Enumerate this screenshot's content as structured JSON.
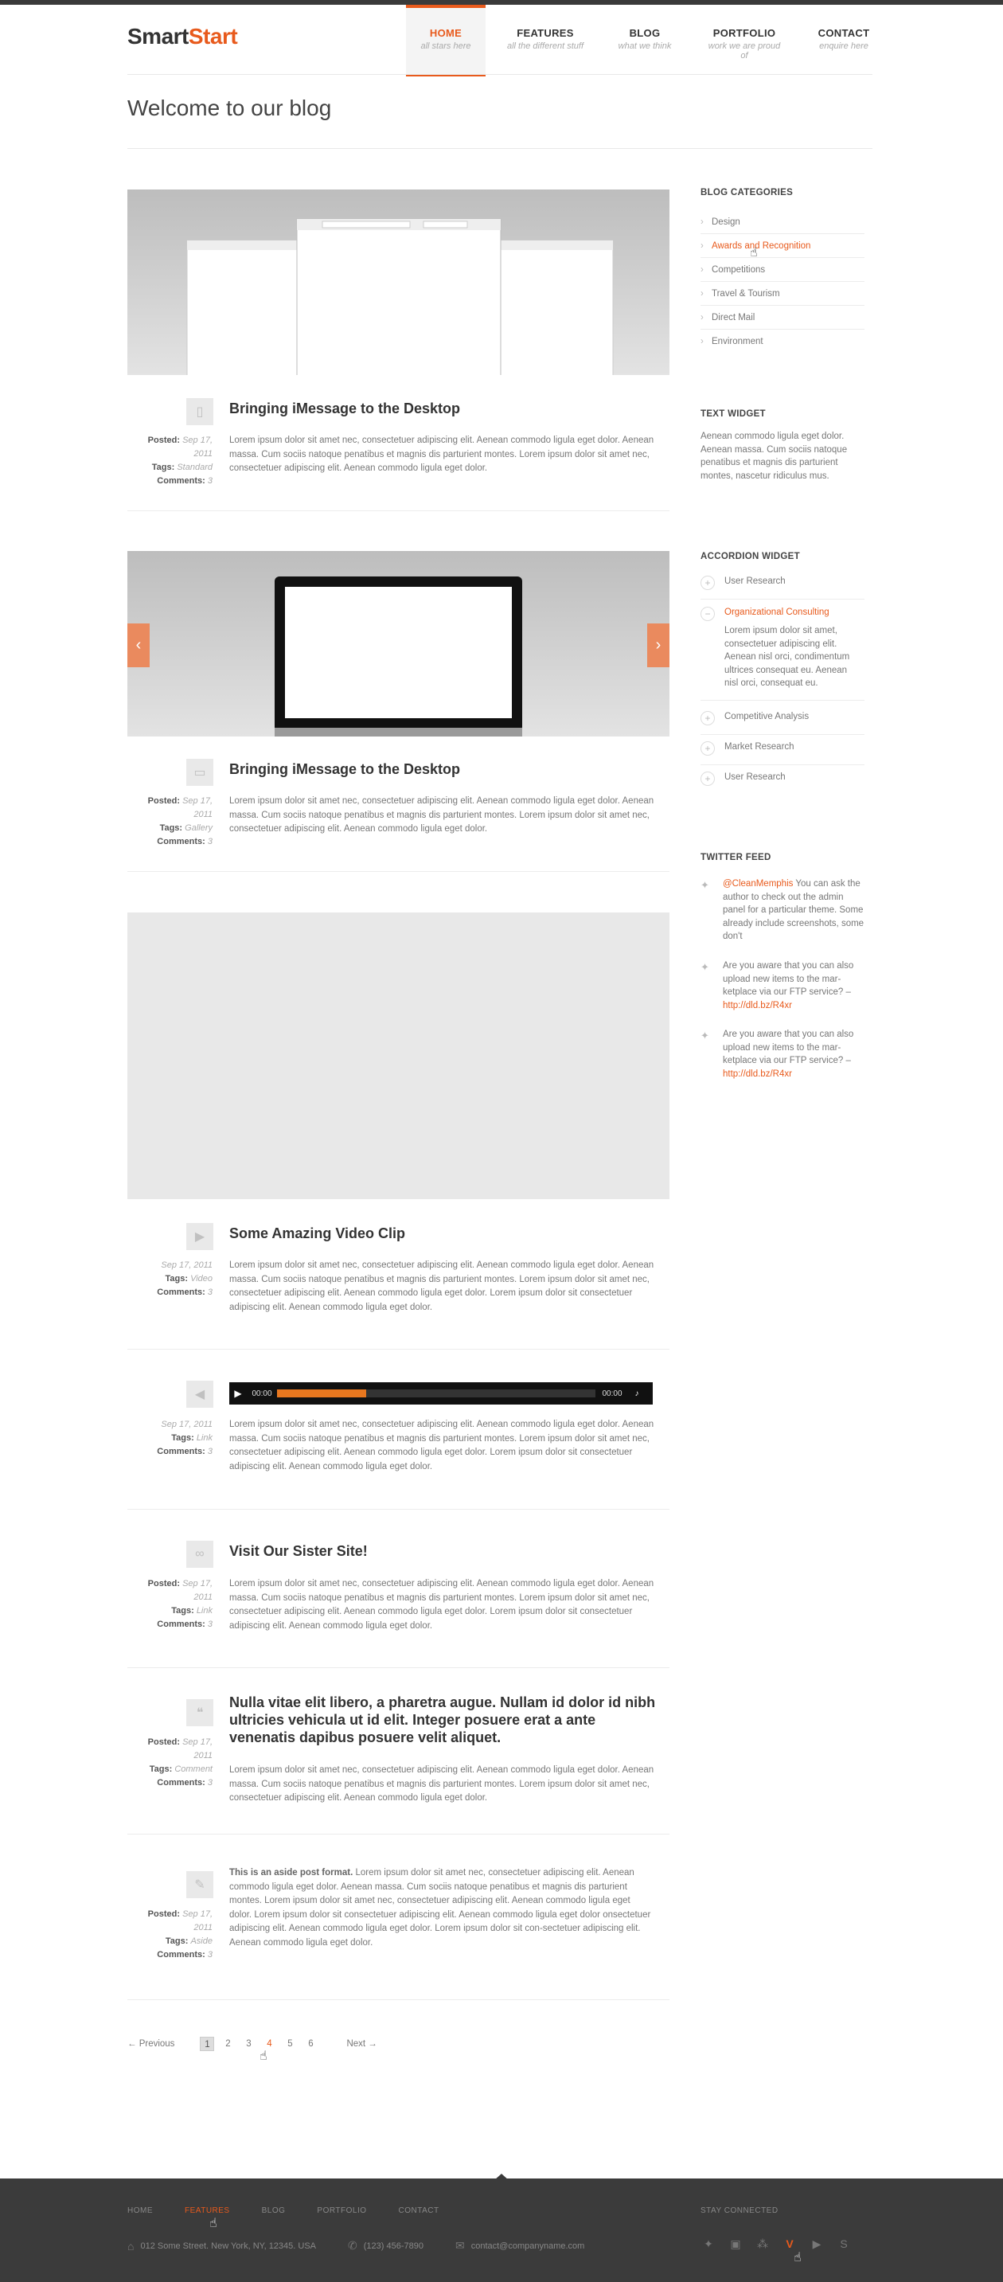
{
  "brand": {
    "part1": "Smart",
    "part2": "Start"
  },
  "nav": [
    {
      "title": "HOME",
      "sub": "all stars here",
      "active": true
    },
    {
      "title": "FEATURES",
      "sub": "all the different stuff",
      "active": false
    },
    {
      "title": "BLOG",
      "sub": "what we think",
      "active": false
    },
    {
      "title": "PORTFOLIO",
      "sub": "work we are proud of",
      "active": false
    },
    {
      "title": "CONTACT",
      "sub": "enquire here",
      "active": false
    }
  ],
  "page_title": "Welcome to our blog",
  "lorem3": "Lorem ipsum dolor sit amet nec, consectetuer adipiscing elit. Aenean commodo ligula eget dolor. Aenean massa. Cum sociis natoque penatibus et magnis dis parturient montes. Lorem ipsum dolor sit amet nec, consectetuer adipiscing elit. Aenean commodo ligula eget dolor.",
  "lorem4": "Lorem ipsum dolor sit amet nec, consectetuer adipiscing elit. Aenean commodo ligula eget dolor. Aenean massa. Cum sociis natoque penatibus et magnis dis parturient montes. Lorem ipsum dolor sit amet nec, consectetuer adipiscing elit. Aenean commodo ligula eget dolor. Lorem ipsum dolor sit consectetuer adipiscing elit. Aenean commodo ligula eget dolor.",
  "labels": {
    "posted": "Posted:",
    "tags": "Tags:",
    "comments": "Comments:"
  },
  "posts": [
    {
      "title": "Bringing iMessage to the Desktop",
      "date": "Sep 17, 2011",
      "tag": "Standard",
      "comments": "3",
      "icon": "document-icon"
    },
    {
      "title": "Bringing iMessage to the Desktop",
      "date": "Sep 17, 2011",
      "tag": "Gallery",
      "comments": "3",
      "icon": "image-icon"
    },
    {
      "title": "Some Amazing Video Clip",
      "date": "Sep 17, 2011",
      "tag": "Video",
      "comments": "3",
      "icon": "play-icon"
    },
    {
      "title": "",
      "date": "Sep 17, 2011",
      "tag": "Link",
      "comments": "3",
      "icon": "audio-icon"
    },
    {
      "title": "Visit Our Sister Site!",
      "date": "Sep 17, 2011",
      "tag": "Link",
      "comments": "3",
      "icon": "link-icon"
    },
    {
      "title": "Nulla vitae elit libero, a pharetra augue. Nullam id dolor id nibh ultricies vehicula ut id elit. Integer posuere erat a ante venenatis dapibus posuere velit aliquet.",
      "date": "Sep 17, 2011",
      "tag": "Comment",
      "comments": "3",
      "icon": "quote-icon"
    },
    {
      "title": "",
      "date": "Sep 17, 2011",
      "tag": "Aside",
      "comments": "3",
      "icon": "pencil-icon",
      "lead": "This is an aside post format.",
      "body": "Lorem ipsum dolor sit amet nec, consectetuer adipiscing elit. Aenean commodo ligula eget dolor. Aenean massa. Cum sociis natoque penatibus et magnis dis parturient montes. Lorem ipsum dolor sit amet nec, consectetuer adipiscing elit. Aenean commodo ligula eget dolor. Lorem ipsum dolor sit consectetuer adipiscing elit. Aenean commodo ligula eget dolor onsectetuer adipiscing elit. Aenean commodo ligula eget dolor. Lorem ipsum dolor sit con-sectetuer adipiscing elit. Aenean commodo ligula eget dolor."
    }
  ],
  "audio": {
    "time_start": "00:00",
    "time_end": "00:00",
    "progress": 0.28
  },
  "sidebar": {
    "categories_title": "BLOG CATEGORIES",
    "categories": [
      "Design",
      "Awards and Recognition",
      "Competitions",
      "Travel & Tourism",
      "Direct Mail",
      "Environment"
    ],
    "active_category": 1,
    "text_widget_title": "TEXT WIDGET",
    "text_widget_body": "Aenean commodo ligula eget dolor. Aenean massa. Cum sociis natoque penatibus et magnis dis parturient montes, nascetur ridiculus mus.",
    "accordion_title": "ACCORDION WIDGET",
    "accordion": [
      "User Research",
      "Organizational Consulting",
      "Competitive Analysis",
      "Market Research",
      "User Research"
    ],
    "accordion_open_body": "Lorem ipsum dolor sit amet, consectetuer adipiscing elit. Aenean nisl orci, condimentum ultrices consequat eu. Aenean nisl orci, consequat eu.",
    "twitter_title": "TWITTER FEED",
    "tweets": [
      {
        "handle": "@CleanMemphis",
        "text": "You can ask the author to check out the admin panel for a particular theme. Some already include screenshots, some don't",
        "link": ""
      },
      {
        "handle": "",
        "text": "Are you aware that you can also upload new items to the mar-ketplace via our FTP service? –",
        "link": "http://dld.bz/R4xr"
      },
      {
        "handle": "",
        "text": "Are you aware that you can also upload new items to the mar-ketplace via our FTP service? –",
        "link": "http://dld.bz/R4xr"
      }
    ]
  },
  "pagination": {
    "prev": "← Previous",
    "next": "Next →",
    "pages": [
      "1",
      "2",
      "3",
      "4",
      "5",
      "6"
    ],
    "current": "1",
    "hover": "4"
  },
  "footer": {
    "links": [
      "HOME",
      "FEATURES",
      "BLOG",
      "PORTFOLIO",
      "CONTACT"
    ],
    "active_link": "FEATURES",
    "address": "012 Some Street. New York, NY, 12345. USA",
    "phone": "(123) 456-7890",
    "email": "contact@companyname.com",
    "stay_connected": "STAY CONNECTED",
    "social": [
      "twitter-icon",
      "facebook-icon",
      "flickr-icon",
      "vimeo-icon",
      "youtube-icon",
      "skype-icon"
    ]
  },
  "colors": {
    "accent": "#e85a1c",
    "footer": "#3b3b3b"
  }
}
